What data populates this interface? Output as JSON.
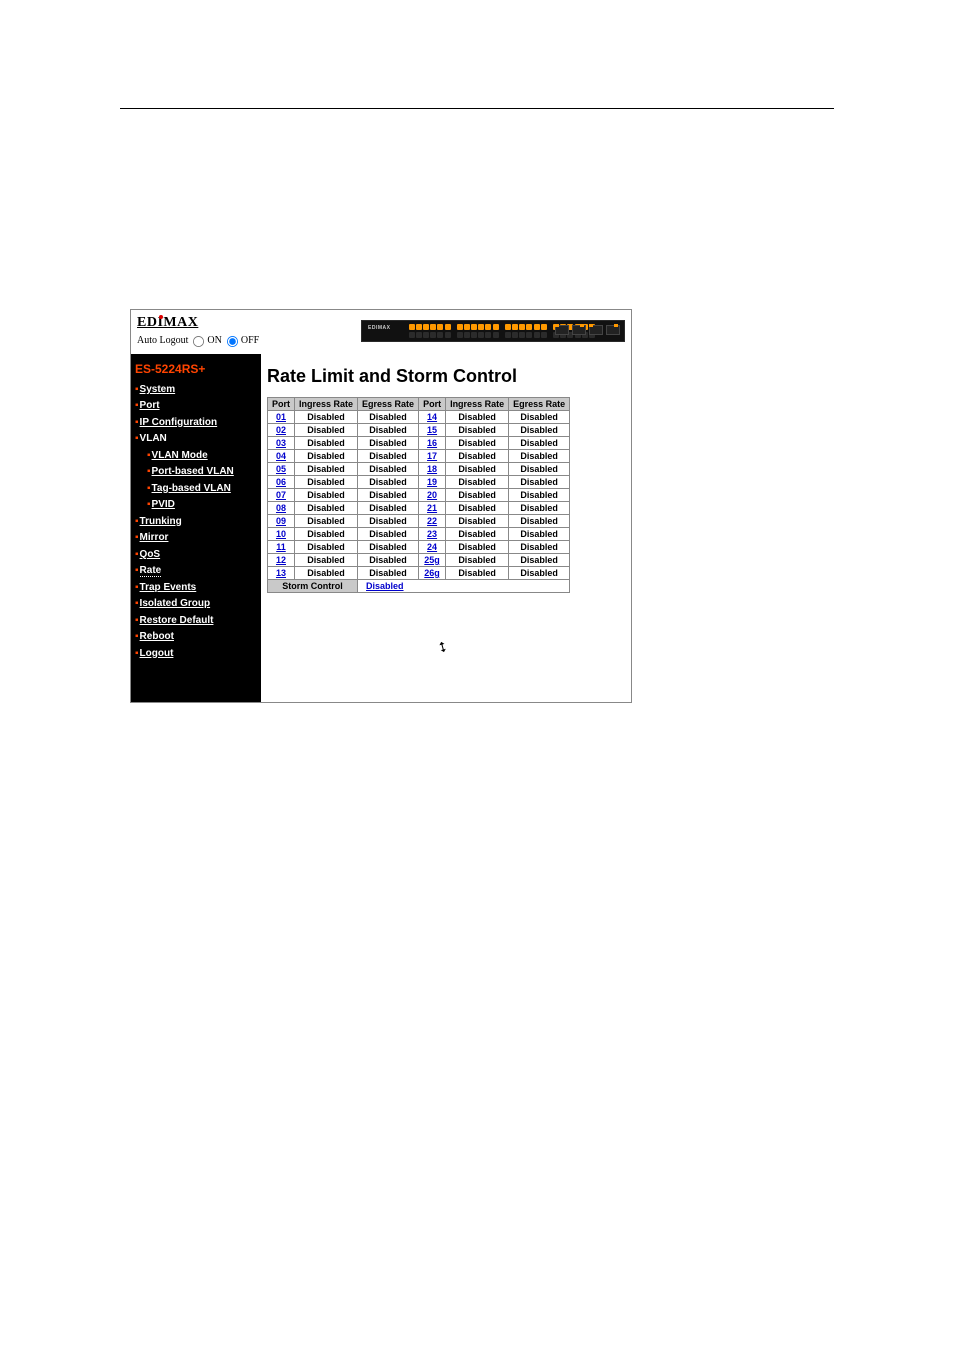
{
  "header": {
    "brand": "EDIMAX",
    "auto_logout_label": "Auto Logout",
    "on_label": "ON",
    "off_label": "OFF",
    "device_label": "EDIMAX"
  },
  "sidebar": {
    "model": "ES-5224RS+",
    "items": [
      {
        "label": "System",
        "level": 0,
        "link": true
      },
      {
        "label": "Port",
        "level": 0,
        "link": true
      },
      {
        "label": "IP Configuration",
        "level": 0,
        "link": true
      },
      {
        "label": "VLAN",
        "level": 0,
        "link": false,
        "plain": true
      },
      {
        "label": "VLAN Mode",
        "level": 1,
        "link": true
      },
      {
        "label": "Port-based VLAN",
        "level": 1,
        "link": true
      },
      {
        "label": "Tag-based VLAN",
        "level": 1,
        "link": true
      },
      {
        "label": "PVID",
        "level": 1,
        "link": true
      },
      {
        "label": "Trunking",
        "level": 0,
        "link": true
      },
      {
        "label": "Mirror",
        "level": 0,
        "link": true
      },
      {
        "label": "QoS",
        "level": 0,
        "link": true
      },
      {
        "label": "Rate",
        "level": 0,
        "link": true,
        "current": true
      },
      {
        "label": "Trap Events",
        "level": 0,
        "link": true
      },
      {
        "label": "Isolated Group",
        "level": 0,
        "link": true
      },
      {
        "label": "Restore Default",
        "level": 0,
        "link": true
      },
      {
        "label": "Reboot",
        "level": 0,
        "link": true
      },
      {
        "label": "Logout",
        "level": 0,
        "link": true
      }
    ]
  },
  "main": {
    "title": "Rate Limit and Storm Control",
    "headers": [
      "Port",
      "Ingress Rate",
      "Egress Rate",
      "Port",
      "Ingress Rate",
      "Egress Rate"
    ],
    "rows": [
      {
        "p1": "01",
        "i1": "Disabled",
        "e1": "Disabled",
        "p2": "14",
        "i2": "Disabled",
        "e2": "Disabled"
      },
      {
        "p1": "02",
        "i1": "Disabled",
        "e1": "Disabled",
        "p2": "15",
        "i2": "Disabled",
        "e2": "Disabled"
      },
      {
        "p1": "03",
        "i1": "Disabled",
        "e1": "Disabled",
        "p2": "16",
        "i2": "Disabled",
        "e2": "Disabled"
      },
      {
        "p1": "04",
        "i1": "Disabled",
        "e1": "Disabled",
        "p2": "17",
        "i2": "Disabled",
        "e2": "Disabled"
      },
      {
        "p1": "05",
        "i1": "Disabled",
        "e1": "Disabled",
        "p2": "18",
        "i2": "Disabled",
        "e2": "Disabled"
      },
      {
        "p1": "06",
        "i1": "Disabled",
        "e1": "Disabled",
        "p2": "19",
        "i2": "Disabled",
        "e2": "Disabled"
      },
      {
        "p1": "07",
        "i1": "Disabled",
        "e1": "Disabled",
        "p2": "20",
        "i2": "Disabled",
        "e2": "Disabled"
      },
      {
        "p1": "08",
        "i1": "Disabled",
        "e1": "Disabled",
        "p2": "21",
        "i2": "Disabled",
        "e2": "Disabled"
      },
      {
        "p1": "09",
        "i1": "Disabled",
        "e1": "Disabled",
        "p2": "22",
        "i2": "Disabled",
        "e2": "Disabled"
      },
      {
        "p1": "10",
        "i1": "Disabled",
        "e1": "Disabled",
        "p2": "23",
        "i2": "Disabled",
        "e2": "Disabled"
      },
      {
        "p1": "11",
        "i1": "Disabled",
        "e1": "Disabled",
        "p2": "24",
        "i2": "Disabled",
        "e2": "Disabled"
      },
      {
        "p1": "12",
        "i1": "Disabled",
        "e1": "Disabled",
        "p2": "25g",
        "i2": "Disabled",
        "e2": "Disabled"
      },
      {
        "p1": "13",
        "i1": "Disabled",
        "e1": "Disabled",
        "p2": "26g",
        "i2": "Disabled",
        "e2": "Disabled"
      }
    ],
    "storm_label": "Storm Control",
    "storm_value": "Disabled"
  }
}
